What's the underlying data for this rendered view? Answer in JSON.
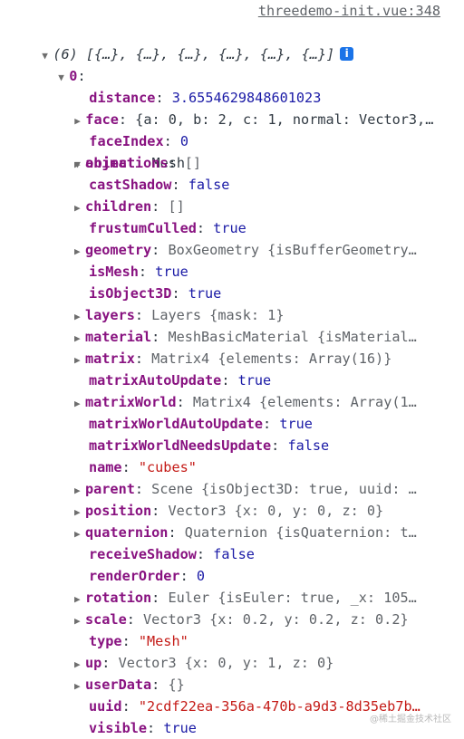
{
  "source_link": "threedemo-init.vue:348",
  "array_summary": "(6) [{…}, {…}, {…}, {…}, {…}, {…}]",
  "index0_key": "0",
  "props": {
    "distance": {
      "key": "distance",
      "value": "3.6554629848601023"
    },
    "face": {
      "key": "face",
      "value": "{a: 0, b: 2, c: 1, normal: Vector3,…"
    },
    "faceIndex": {
      "key": "faceIndex",
      "value": "0"
    },
    "object": {
      "key": "object",
      "value": "Mesh"
    }
  },
  "mesh_props": [
    {
      "key": "animations",
      "value": "[]",
      "type": "c",
      "expandable": true
    },
    {
      "key": "castShadow",
      "value": "false",
      "type": "b",
      "expandable": false
    },
    {
      "key": "children",
      "value": "[]",
      "type": "c",
      "expandable": true
    },
    {
      "key": "frustumCulled",
      "value": "true",
      "type": "b",
      "expandable": false
    },
    {
      "key": "geometry",
      "value": "BoxGeometry {isBufferGeometry…",
      "type": "c",
      "expandable": true
    },
    {
      "key": "isMesh",
      "value": "true",
      "type": "b",
      "expandable": false
    },
    {
      "key": "isObject3D",
      "value": "true",
      "type": "b",
      "expandable": false
    },
    {
      "key": "layers",
      "value": "Layers {mask: 1}",
      "type": "c",
      "expandable": true
    },
    {
      "key": "material",
      "value": "MeshBasicMaterial {isMaterial…",
      "type": "c",
      "expandable": true
    },
    {
      "key": "matrix",
      "value": "Matrix4 {elements: Array(16)}",
      "type": "c",
      "expandable": true
    },
    {
      "key": "matrixAutoUpdate",
      "value": "true",
      "type": "b",
      "expandable": false
    },
    {
      "key": "matrixWorld",
      "value": "Matrix4 {elements: Array(1…",
      "type": "c",
      "expandable": true
    },
    {
      "key": "matrixWorldAutoUpdate",
      "value": "true",
      "type": "b",
      "expandable": false
    },
    {
      "key": "matrixWorldNeedsUpdate",
      "value": "false",
      "type": "b",
      "expandable": false
    },
    {
      "key": "name",
      "value": "\"cubes\"",
      "type": "s",
      "expandable": false
    },
    {
      "key": "parent",
      "value": "Scene {isObject3D: true, uuid: …",
      "type": "c",
      "expandable": true
    },
    {
      "key": "position",
      "value": "Vector3 {x: 0, y: 0, z: 0}",
      "type": "c",
      "expandable": true
    },
    {
      "key": "quaternion",
      "value": "Quaternion {isQuaternion: t…",
      "type": "c",
      "expandable": true
    },
    {
      "key": "receiveShadow",
      "value": "false",
      "type": "b",
      "expandable": false
    },
    {
      "key": "renderOrder",
      "value": "0",
      "type": "n",
      "expandable": false
    },
    {
      "key": "rotation",
      "value": "Euler {isEuler: true, _x: 105…",
      "type": "c",
      "expandable": true
    },
    {
      "key": "scale",
      "value": "Vector3 {x: 0.2, y: 0.2, z: 0.2}",
      "type": "c",
      "expandable": true
    },
    {
      "key": "type",
      "value": "\"Mesh\"",
      "type": "s",
      "expandable": false
    },
    {
      "key": "up",
      "value": "Vector3 {x: 0, y: 1, z: 0}",
      "type": "c",
      "expandable": true
    },
    {
      "key": "userData",
      "value": "{}",
      "type": "c",
      "expandable": true
    },
    {
      "key": "uuid",
      "value": "\"2cdf22ea-356a-470b-a9d3-8d35eb7b…",
      "type": "s",
      "expandable": false
    },
    {
      "key": "visible",
      "value": "true",
      "type": "b",
      "expandable": false
    }
  ],
  "watermark": "@稀土掘金技术社区",
  "colors": {
    "key": "#881280",
    "bool_num": "#1a1aa6",
    "string": "#c41a16",
    "link": "#5f6368"
  }
}
